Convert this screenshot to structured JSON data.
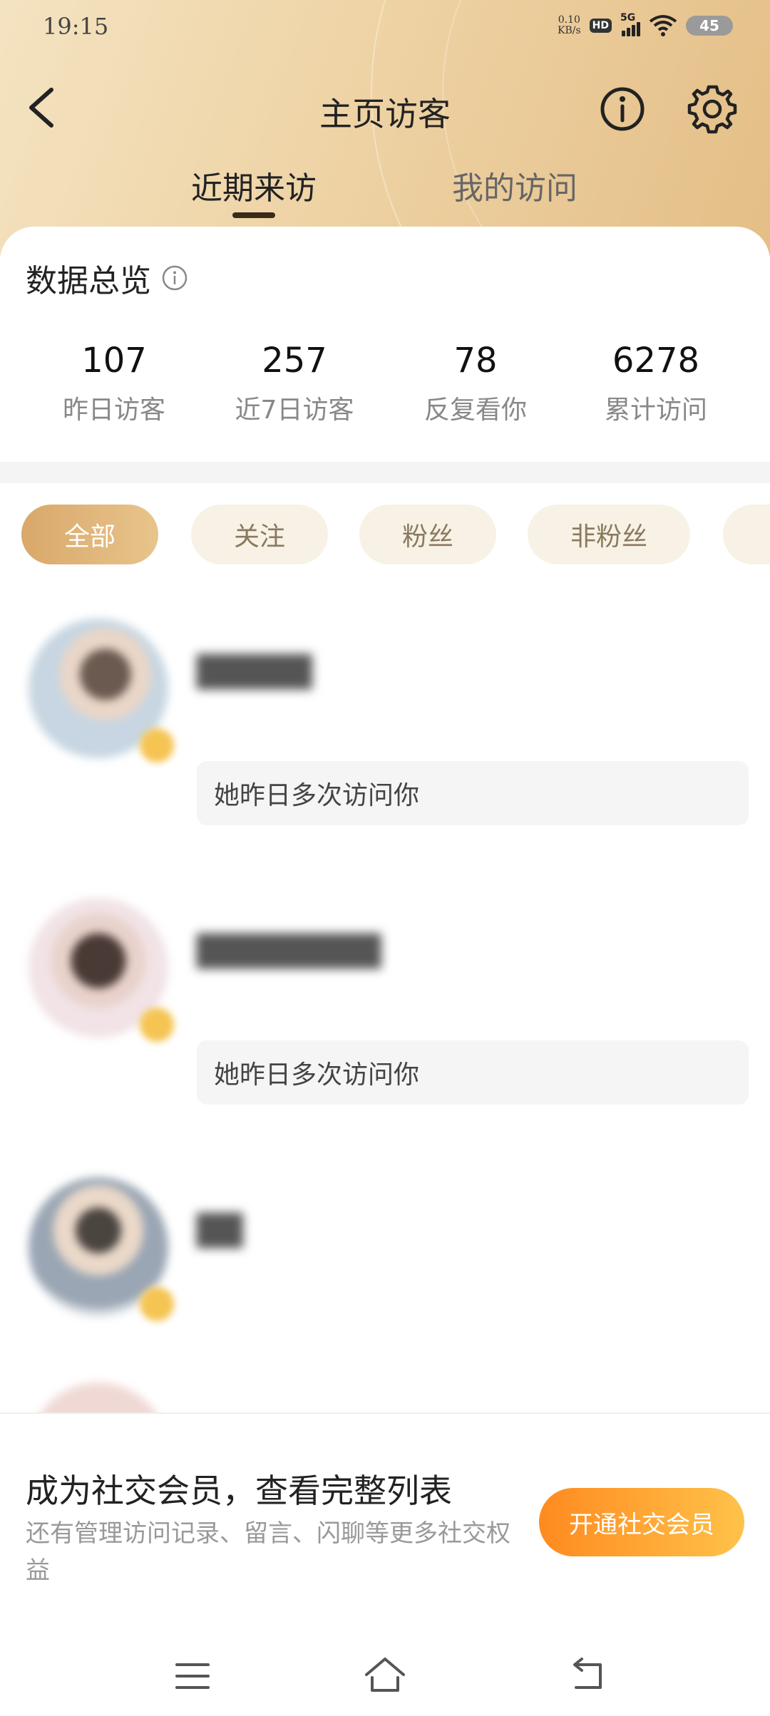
{
  "status_bar": {
    "time": "19:15",
    "net_speed_value": "0.10",
    "net_speed_unit": "KB/s",
    "hd": "HD",
    "network": "5G",
    "battery": "45"
  },
  "nav": {
    "title": "主页访客",
    "back_icon": "chevron-left-icon",
    "info_icon": "info-circle-icon",
    "settings_icon": "gear-icon"
  },
  "tabs": [
    {
      "label": "近期来访",
      "active": true
    },
    {
      "label": "我的访问",
      "active": false
    }
  ],
  "overview": {
    "title": "数据总览",
    "stats": [
      {
        "value": "107",
        "label": "昨日访客"
      },
      {
        "value": "257",
        "label": "近7日访客"
      },
      {
        "value": "78",
        "label": "反复看你"
      },
      {
        "value": "6278",
        "label": "累计访问"
      }
    ]
  },
  "filters": [
    {
      "label": "全部",
      "active": true
    },
    {
      "label": "关注",
      "active": false
    },
    {
      "label": "粉丝",
      "active": false
    },
    {
      "label": "非粉丝",
      "active": false
    },
    {
      "label": "",
      "active": false
    }
  ],
  "visitors": [
    {
      "name": "█████",
      "note": "她昨日多次访问你"
    },
    {
      "name": "████████",
      "note": "她昨日多次访问你"
    },
    {
      "name": "██",
      "note": ""
    },
    {
      "name": "",
      "note": ""
    }
  ],
  "membership": {
    "title": "成为社交会员，查看完整列表",
    "subtitle": "还有管理访问记录、留言、闪聊等更多社交权益",
    "button": "开通社交会员"
  },
  "colors": {
    "header_gradient_start": "#f4e3c1",
    "header_gradient_end": "#e4be86",
    "active_chip": "#d9a86a",
    "cta_start": "#ff8a1f",
    "cta_end": "#ffc24a"
  }
}
